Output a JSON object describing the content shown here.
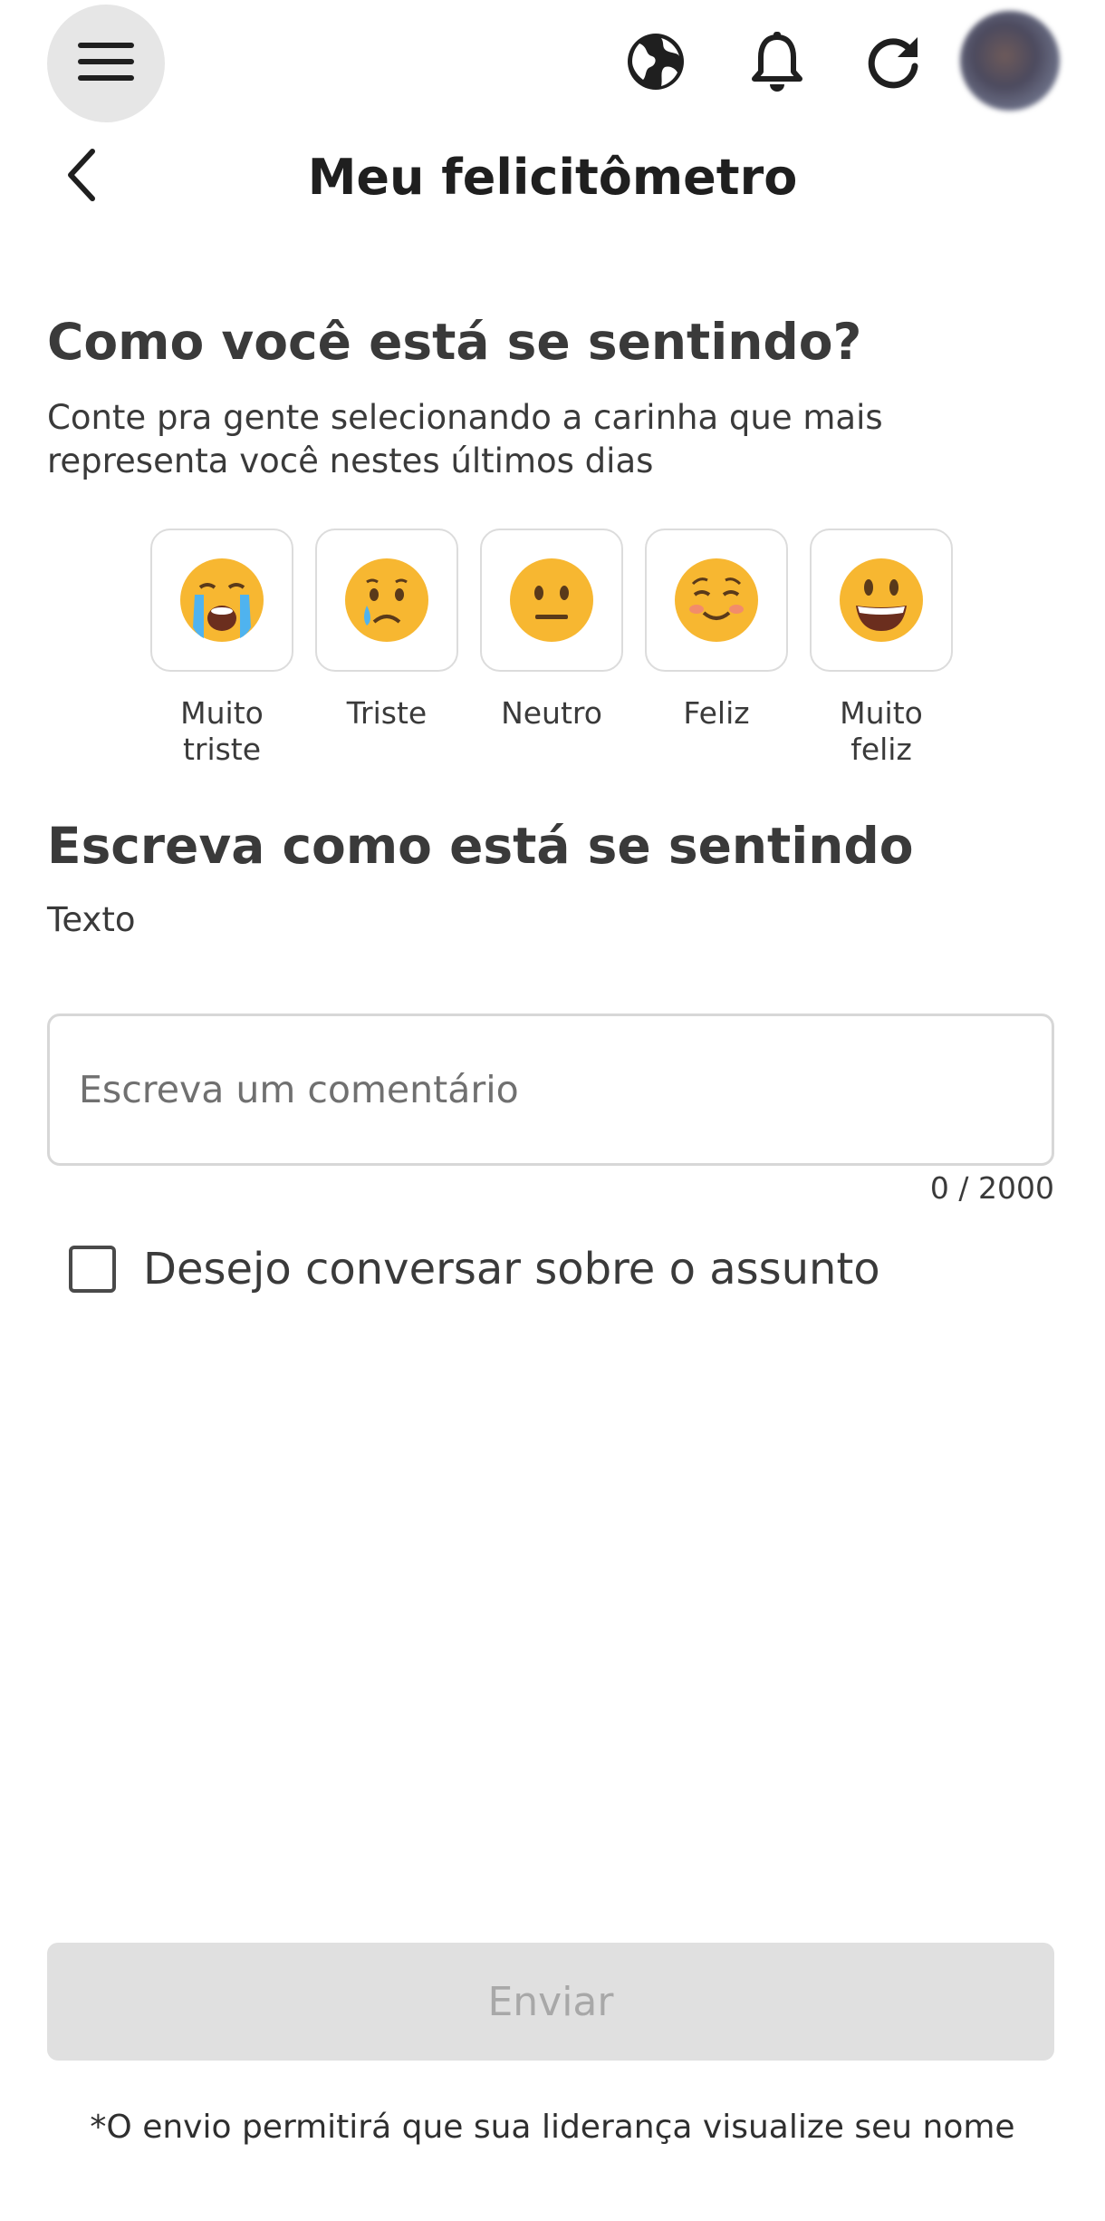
{
  "header": {
    "title": "Meu felicitômetro"
  },
  "icons": {
    "menu": "hamburger-menu-icon",
    "globe": "globe-icon",
    "notifications": "bell-icon",
    "refresh": "refresh-icon",
    "back": "chevron-left-icon"
  },
  "mood_section": {
    "title": "Como você está se sentindo?",
    "subtitle": "Conte pra gente selecionando a carinha que mais representa você nestes últimos dias",
    "options": [
      {
        "label": "Muito\ntriste",
        "emoji": "😭"
      },
      {
        "label": "Triste",
        "emoji": "😢"
      },
      {
        "label": "Neutro",
        "emoji": "😐"
      },
      {
        "label": "Feliz",
        "emoji": "☺️"
      },
      {
        "label": "Muito\nfeliz",
        "emoji": "😃"
      }
    ]
  },
  "comment_section": {
    "title": "Escreva como está se sentindo",
    "field_label": "Texto",
    "placeholder": "Escreva um comentário",
    "value": "",
    "counter": "0 / 2000"
  },
  "talk_checkbox": {
    "label": "Desejo conversar sobre o assunto",
    "checked": false
  },
  "submit": {
    "label": "Enviar",
    "disabled": true
  },
  "footnote": "*O envio permitirá que sua liderança visualize seu nome",
  "colors": {
    "button_disabled_bg": "#e0e0e0",
    "button_disabled_text": "#a8a8a8",
    "text_primary": "#3a3a3a"
  }
}
